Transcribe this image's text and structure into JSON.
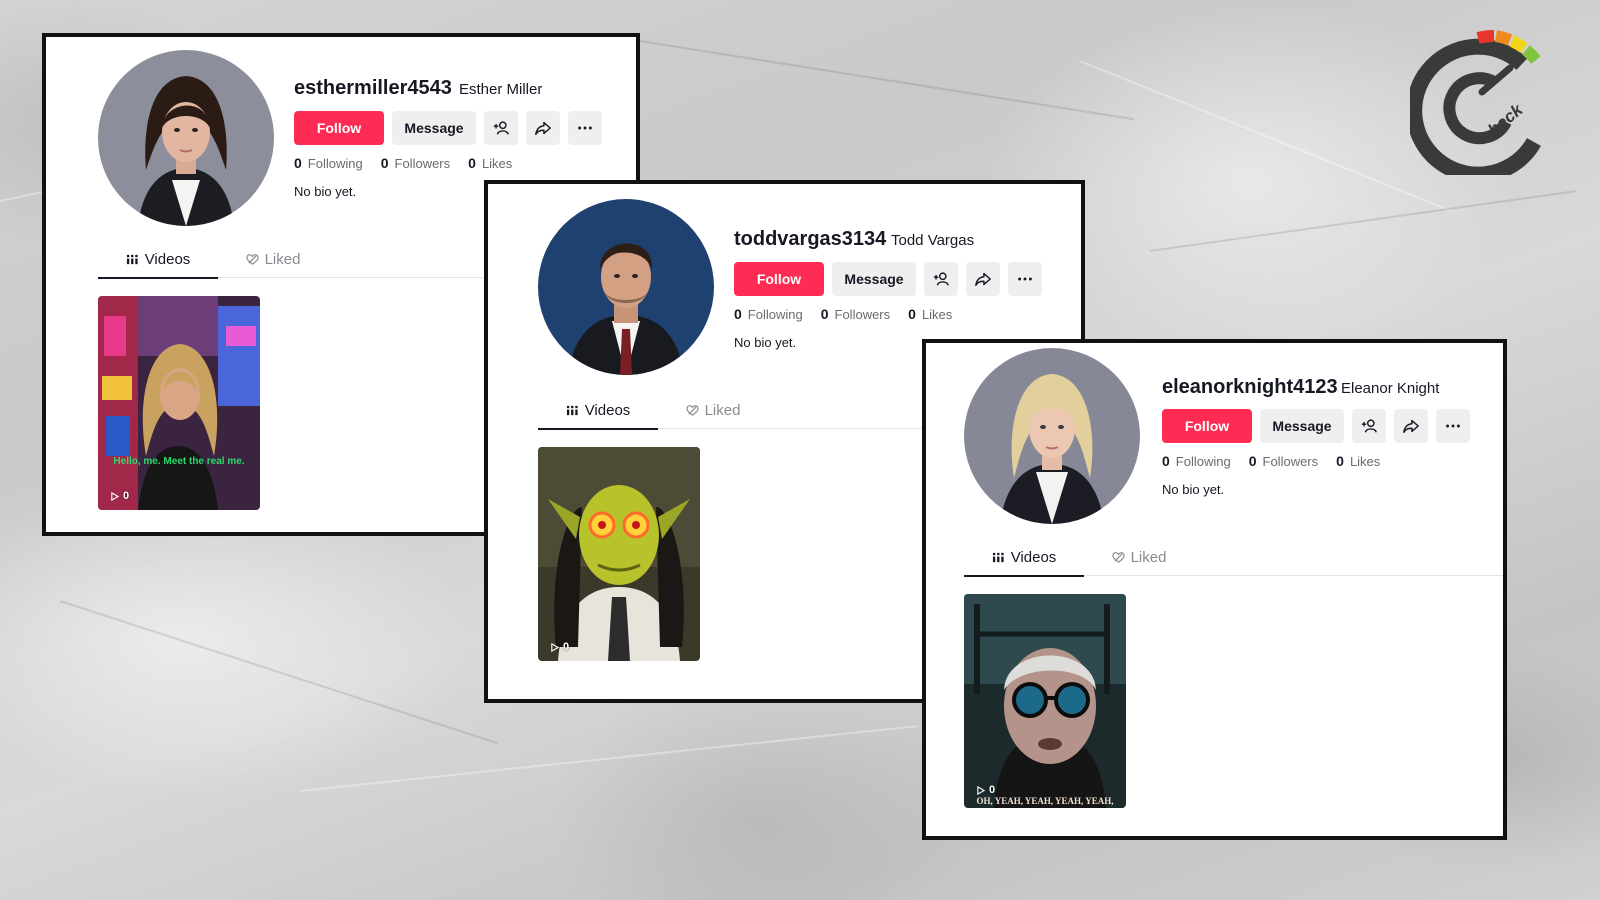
{
  "profiles": [
    {
      "username": "esthermiller4543",
      "display_name": "Esther Miller",
      "follow_label": "Follow",
      "message_label": "Message",
      "following_count": "0",
      "following_label": "Following",
      "followers_count": "0",
      "followers_label": "Followers",
      "likes_count": "0",
      "likes_label": "Likes",
      "bio": "No bio yet.",
      "tab_videos": "Videos",
      "tab_liked": "Liked",
      "video": {
        "play_count": "0",
        "caption": "Hello, me. Meet the real me."
      }
    },
    {
      "username": "toddvargas3134",
      "display_name": "Todd Vargas",
      "follow_label": "Follow",
      "message_label": "Message",
      "following_count": "0",
      "following_label": "Following",
      "followers_count": "0",
      "followers_label": "Followers",
      "likes_count": "0",
      "likes_label": "Likes",
      "bio": "No bio yet.",
      "tab_videos": "Videos",
      "tab_liked": "Liked",
      "video": {
        "play_count": "0"
      }
    },
    {
      "username": "eleanorknight4123",
      "display_name": "Eleanor Knight",
      "follow_label": "Follow",
      "message_label": "Message",
      "following_count": "0",
      "following_label": "Following",
      "followers_count": "0",
      "followers_label": "Followers",
      "likes_count": "0",
      "likes_label": "Likes",
      "bio": "No bio yet.",
      "tab_videos": "Videos",
      "tab_liked": "Liked",
      "video": {
        "play_count": "0",
        "caption": "OH, YEAH, YEAH, YEAH, YEAH,"
      }
    }
  ],
  "colors": {
    "follow": "#fe2c55",
    "secondary_button": "#efefef",
    "text": "#161823",
    "muted_text": "#8a8b91"
  },
  "icons": [
    "add-friend-icon",
    "share-icon",
    "more-icon",
    "videos-grid-icon",
    "liked-heart-icon",
    "play-icon",
    "check-logo-icon"
  ]
}
